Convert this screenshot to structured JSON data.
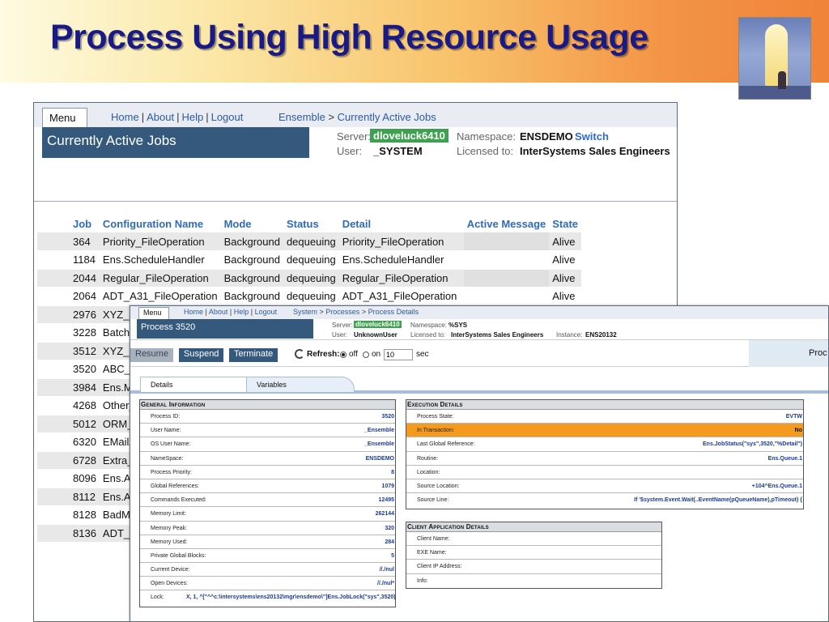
{
  "slide": {
    "title": "Process Using High Resource Usage"
  },
  "jobs_page": {
    "menu_tab": "Menu",
    "nav_links": [
      "Home",
      "About",
      "Help",
      "Logout"
    ],
    "breadcrumb_root": "Ensemble",
    "breadcrumb_sep": ">",
    "breadcrumb_current": "Currently Active Jobs",
    "title": "Currently Active Jobs",
    "server_label": "Server:",
    "server_value": "dloveluck6410",
    "user_label": "User:",
    "user_value": "_SYSTEM",
    "namespace_label": "Namespace:",
    "namespace_value": "ENSDEMO",
    "switch_link": "Switch",
    "licensed_label": "Licensed to:",
    "licensed_value": "InterSystems Sales Engineers",
    "columns": [
      "Job",
      "Configuration Name",
      "Mode",
      "Status",
      "Detail",
      "Active Message",
      "State"
    ],
    "rows": [
      [
        "364",
        "Priority_FileOperation",
        "Background",
        "dequeuing",
        "Priority_FileOperation",
        "",
        "Alive"
      ],
      [
        "1184",
        "Ens.ScheduleHandler",
        "Background",
        "dequeuing",
        "Ens.ScheduleHandler",
        "",
        "Alive"
      ],
      [
        "2044",
        "Regular_FileOperation",
        "Background",
        "dequeuing",
        "Regular_FileOperation",
        "",
        "Alive"
      ],
      [
        "2064",
        "ADT_A31_FileOperation",
        "Background",
        "dequeuing",
        "ADT_A31_FileOperation",
        "",
        "Alive"
      ],
      [
        "2976",
        "XYZ_F"
      ],
      [
        "3228",
        "Batch_"
      ],
      [
        "3512",
        "XYZ_H"
      ],
      [
        "3520",
        "ABC_I"
      ],
      [
        "3984",
        "Ens.M"
      ],
      [
        "4268",
        "Other_"
      ],
      [
        "5012",
        "ORM_"
      ],
      [
        "6320",
        "EMailA"
      ],
      [
        "6728",
        "Extra_"
      ],
      [
        "8096",
        "Ens.A"
      ],
      [
        "8112",
        "Ens.Al"
      ],
      [
        "8128",
        "BadMe"
      ],
      [
        "8136",
        "ADT_A"
      ]
    ]
  },
  "process_page": {
    "menu_tab": "Menu",
    "nav_links": [
      "Home",
      "About",
      "Help",
      "Logout"
    ],
    "breadcrumb_root": "System",
    "breadcrumb_mid": "Processes",
    "breadcrumb_current": "Process Details",
    "title": "Process 3520",
    "server_label": "Server:",
    "server_value": "dloveluck6410",
    "user_label": "User:",
    "user_value": "UnknownUser",
    "namespace_label": "Namespace:",
    "namespace_value": "%SYS",
    "licensed_label": "Licensed to:",
    "licensed_value": "InterSystems Sales Engineers",
    "instance_label": "Instance:",
    "instance_value": "ENS20132",
    "buttons": {
      "resume": "Resume",
      "suspend": "Suspend",
      "terminate": "Terminate"
    },
    "refresh_label": "Refresh:",
    "refresh_off": "off",
    "refresh_on": "on",
    "refresh_seconds": "10",
    "refresh_unit": "sec",
    "right_panel_label": "Proc",
    "tabs": [
      "Details",
      "Variables"
    ],
    "general": {
      "heading": "General Information",
      "rows": [
        {
          "k": "Process ID:",
          "v": "3520"
        },
        {
          "k": "User Name:",
          "v": "_Ensemble"
        },
        {
          "k": "OS User Name:",
          "v": "_Ensemble"
        },
        {
          "k": "NameSpace:",
          "v": "ENSDEMO"
        },
        {
          "k": "Process Priority:",
          "v": "8"
        },
        {
          "k": "Global References:",
          "v": "1079"
        },
        {
          "k": "Commands Executed:",
          "v": "12495"
        },
        {
          "k": "Memory Limit:",
          "v": "262144"
        },
        {
          "k": "Memory Peak:",
          "v": "320"
        },
        {
          "k": "Memory Used:",
          "v": "284"
        },
        {
          "k": "Private Global Blocks:",
          "v": "5"
        },
        {
          "k": "Current Device:",
          "v": "//./nul"
        },
        {
          "k": "Open Devices:",
          "v": "//./nul*"
        },
        {
          "k": "Lock:",
          "v": "X, 1, ^[\"^^c:\\intersystems\\ens20132\\mgr\\ensdemo\\\"]Ens.JobLock(\"sys\",3520)"
        }
      ]
    },
    "execution": {
      "heading": "Execution Details",
      "rows": [
        {
          "k": "Process State:",
          "v": "EVTW"
        },
        {
          "k": "In Transaction:",
          "v": "No"
        },
        {
          "k": "Last Global Reference:",
          "v": "Ens.JobStatus(\"sys\",3520,\"%Detail\")"
        },
        {
          "k": "Routine:",
          "v": "Ens.Queue.1"
        },
        {
          "k": "Location:",
          "v": ""
        },
        {
          "k": "Source Location:",
          "v": "+104^Ens.Queue.1"
        },
        {
          "k": "Source Line:",
          "v": "If '$system.Event.Wait(..EventName(pQueueName),pTimeout) {"
        }
      ]
    },
    "client": {
      "heading": "Client Application Details",
      "rows": [
        {
          "k": "Client Name:",
          "v": ""
        },
        {
          "k": "EXE Name:",
          "v": ""
        },
        {
          "k": "Client IP Address:",
          "v": ""
        },
        {
          "k": "Info:",
          "v": ""
        }
      ]
    }
  }
}
